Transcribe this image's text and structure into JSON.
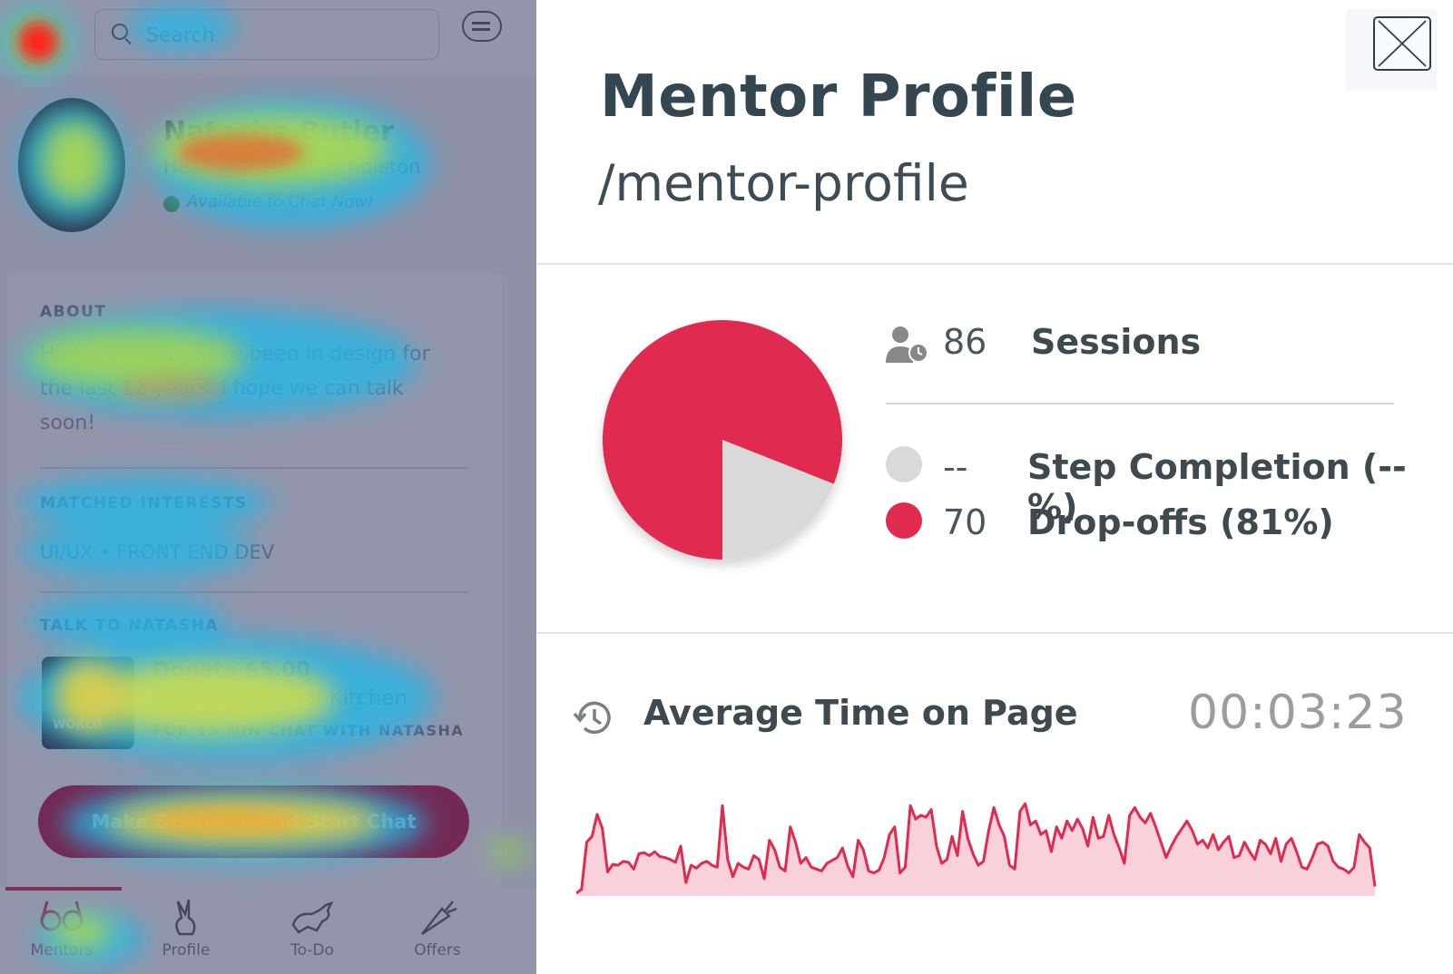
{
  "app": {
    "search_placeholder": "Search",
    "mentor": {
      "name": "Natasha Butler",
      "title": "Head of Product @ Ableton",
      "availability": "Available to Chat Now!"
    },
    "about": {
      "heading": "ABOUT",
      "text": "Hi, I'm Natasha! I've been in design for the last 12 years. I hope we can talk soon!"
    },
    "interests": {
      "heading": "MATCHED INTERESTS",
      "text": "UI/UX • FRONT END DEV"
    },
    "talk": {
      "heading": "TALK TO NATASHA",
      "donate": "Donate $5.00",
      "donate_to": "to World Central Kitchen",
      "donate_for": "FOR 15 MIN CHAT WITH NATASHA",
      "kitchen_logo_text": "WORLD"
    },
    "cta_label": "Make Donation and Start Chat",
    "tabs": [
      {
        "label": "Mentors",
        "icon": "glasses-icon",
        "active": true
      },
      {
        "label": "Profile",
        "icon": "rabbit-icon",
        "active": false
      },
      {
        "label": "To-Do",
        "icon": "running-rabbit-icon",
        "active": false
      },
      {
        "label": "Offers",
        "icon": "carrot-icon",
        "active": false
      }
    ]
  },
  "panel": {
    "title": "Mentor Profile",
    "path": "/mentor-profile",
    "sessions": {
      "value": "86",
      "label": "Sessions",
      "icon": "user-clock-icon"
    },
    "step_completion": {
      "value": "--",
      "label": "Step Completion (--%)",
      "color": "#d9d9d9"
    },
    "drop_offs": {
      "value": "70",
      "label": "Drop-offs (81%)",
      "color": "#e02b4f"
    },
    "avg_time": {
      "label": "Average Time on Page",
      "value": "00:03:23",
      "icon": "history-icon"
    }
  },
  "chart_data": [
    {
      "type": "pie",
      "labels": [
        "Drop-offs",
        "Step Completion"
      ],
      "values": [
        81,
        19
      ],
      "colors": [
        "#e02b4f",
        "#d9d9d9"
      ]
    },
    {
      "type": "area",
      "values": [
        3,
        7,
        56,
        62,
        85,
        70,
        25,
        33,
        32,
        36,
        35,
        28,
        44,
        45,
        42,
        46,
        41,
        40,
        38,
        35,
        52,
        14,
        32,
        29,
        34,
        36,
        32,
        30,
        94,
        38,
        20,
        34,
        30,
        28,
        42,
        38,
        18,
        58,
        48,
        30,
        26,
        72,
        56,
        34,
        40,
        30,
        28,
        26,
        34,
        37,
        40,
        50,
        31,
        20,
        58,
        48,
        26,
        24,
        27,
        40,
        64,
        72,
        24,
        30,
        94,
        80,
        84,
        82,
        90,
        52,
        34,
        38,
        62,
        42,
        88,
        60,
        44,
        32,
        36,
        68,
        92,
        74,
        62,
        32,
        28,
        88,
        96,
        74,
        78,
        64,
        68,
        46,
        72,
        60,
        78,
        68,
        80,
        70,
        52,
        82,
        60,
        62,
        84,
        64,
        50,
        34,
        84,
        92,
        82,
        76,
        86,
        72,
        56,
        40,
        52,
        62,
        70,
        78,
        68,
        54,
        58,
        50,
        64,
        48,
        56,
        62,
        40,
        42,
        56,
        46,
        38,
        58,
        54,
        44,
        60,
        36,
        54,
        60,
        46,
        30,
        28,
        40,
        54,
        56,
        52,
        36,
        30,
        28,
        24,
        30,
        64,
        56,
        50,
        10
      ]
    }
  ]
}
